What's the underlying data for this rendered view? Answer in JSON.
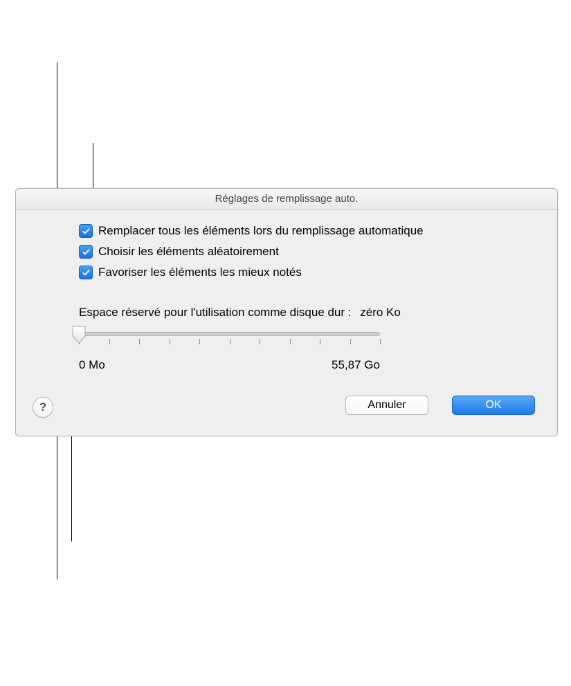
{
  "dialog": {
    "title": "Réglages de remplissage auto.",
    "checkboxes": {
      "replace_all": "Remplacer tous les éléments lors du remplissage automatique",
      "choose_random": "Choisir les éléments aléatoirement",
      "favor_rated": "Favoriser les éléments les mieux notés"
    },
    "slider": {
      "label": "Espace réservé pour l'utilisation comme disque dur :",
      "value": "zéro Ko",
      "min": "0 Mo",
      "max": "55,87 Go"
    },
    "buttons": {
      "help": "?",
      "cancel": "Annuler",
      "ok": "OK"
    }
  }
}
